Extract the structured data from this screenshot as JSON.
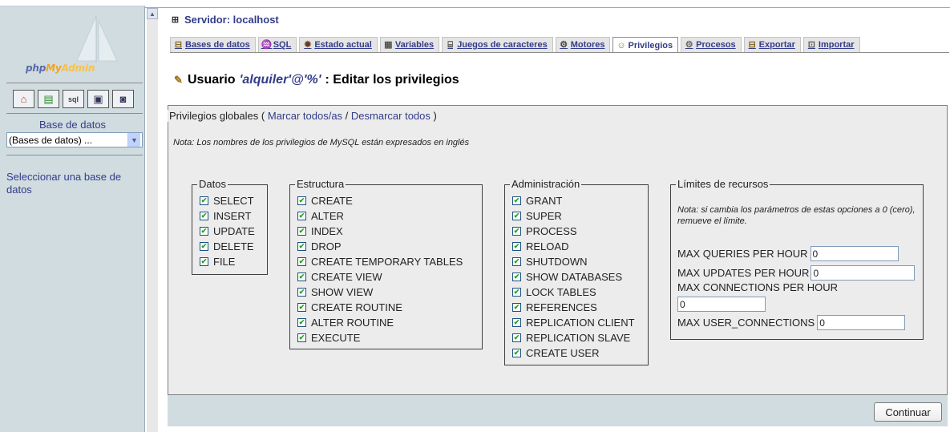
{
  "left": {
    "logo": {
      "php": "php",
      "my": "My",
      "admin": "Admin"
    },
    "quick_icons": [
      "home-icon",
      "query-window-icon",
      "sql-icon",
      "docs-icon",
      "help-icon"
    ],
    "db_label": "Base de datos",
    "db_select_value": "(Bases de datos) ...",
    "select_db_link": "Seleccionar una base de datos"
  },
  "header": {
    "server_title": "Servidor: localhost",
    "tabs": [
      {
        "label": "Bases de datos",
        "icon": "databases-icon"
      },
      {
        "label": "SQL",
        "icon": "sql-icon"
      },
      {
        "label": "Estado actual",
        "icon": "status-icon"
      },
      {
        "label": "Variables",
        "icon": "variables-icon"
      },
      {
        "label": "Juegos de caracteres",
        "icon": "charset-icon"
      },
      {
        "label": "Motores",
        "icon": "engines-icon"
      },
      {
        "label": "Privilegios",
        "icon": "privileges-icon",
        "active": true
      },
      {
        "label": "Procesos",
        "icon": "processes-icon"
      },
      {
        "label": "Exportar",
        "icon": "export-icon"
      },
      {
        "label": "Importar",
        "icon": "import-icon"
      }
    ]
  },
  "page": {
    "title_prefix": "Usuario",
    "title_user": "'alquiler'@'%'",
    "title_suffix": ": Editar los privilegios"
  },
  "privileges": {
    "legend_prefix": "Privilegios globales (",
    "check_all": "Marcar todos/as",
    "separator": " / ",
    "uncheck_all": "Desmarcar todos",
    "legend_suffix": " )",
    "note": "Nota: Los nombres de los privilegios de MySQL están expresados en inglés",
    "groups": {
      "datos": {
        "title": "Datos",
        "items": [
          "SELECT",
          "INSERT",
          "UPDATE",
          "DELETE",
          "FILE"
        ]
      },
      "estructura": {
        "title": "Estructura",
        "items": [
          "CREATE",
          "ALTER",
          "INDEX",
          "DROP",
          "CREATE TEMPORARY TABLES",
          "CREATE VIEW",
          "SHOW VIEW",
          "CREATE ROUTINE",
          "ALTER ROUTINE",
          "EXECUTE"
        ]
      },
      "admin": {
        "title": "Administración",
        "items": [
          "GRANT",
          "SUPER",
          "PROCESS",
          "RELOAD",
          "SHUTDOWN",
          "SHOW DATABASES",
          "LOCK TABLES",
          "REFERENCES",
          "REPLICATION CLIENT",
          "REPLICATION SLAVE",
          "CREATE USER"
        ]
      }
    },
    "limits": {
      "title": "Límites de recursos",
      "note": "Nota: si cambia los parámetros de estas opciones a 0 (cero), remueve el límite.",
      "max_queries_label": "MAX QUERIES PER HOUR",
      "max_queries_value": "0",
      "max_updates_label": "MAX UPDATES PER HOUR",
      "max_updates_value": "0",
      "max_connections_label": "MAX CONNECTIONS PER HOUR",
      "max_connections_value": "0",
      "max_user_connections_label": "MAX USER_CONNECTIONS",
      "max_user_connections_value": "0"
    }
  },
  "footer": {
    "continue_label": "Continuar"
  },
  "colors": {
    "link": "#333c8a",
    "left_bg": "#d0dce0",
    "form_bg": "#ececec",
    "checkmark": "#21a121"
  }
}
